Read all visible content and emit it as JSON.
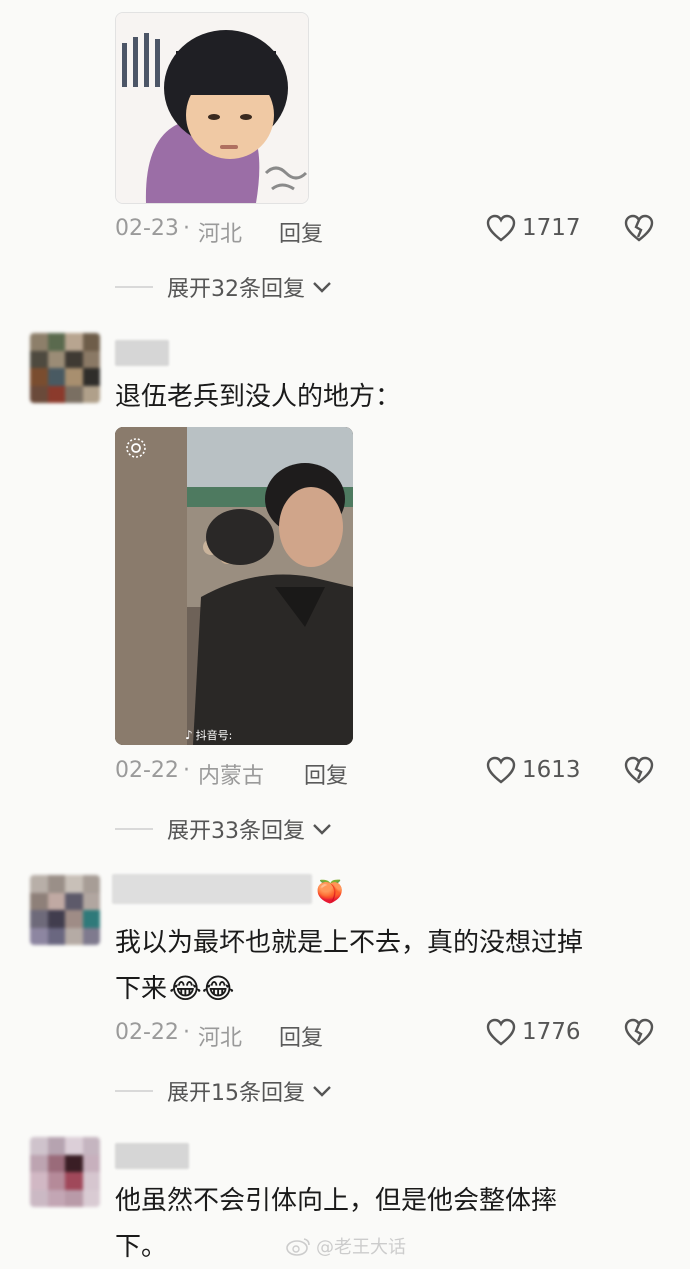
{
  "comments": [
    {
      "date": "02-23",
      "sep": "·",
      "region": "河北",
      "reply_label": "回复",
      "likes": "1717",
      "expand_label": "展开32条回复"
    },
    {
      "text": "退伍老兵到没人的地方：",
      "video_source": "抖音号:",
      "date": "02-22",
      "sep": "·",
      "region": "内蒙古",
      "reply_label": "回复",
      "likes": "1613",
      "expand_label": "展开33条回复"
    },
    {
      "text_line1": "我以为最坏也就是上不去，真的没想过掉",
      "text_line2": "下来",
      "emoji": [
        "😂",
        "😂"
      ],
      "date": "02-22",
      "sep": "·",
      "region": "河北",
      "reply_label": "回复",
      "likes": "1776",
      "expand_label": "展开15条回复"
    },
    {
      "text_line1": "他虽然不会引体向上，但是他会整体摔",
      "text_line2": "下。"
    }
  ],
  "watermark": "@老王大话",
  "colors": {
    "background": "#fafaf8",
    "meta": "#9a9a9a",
    "text": "#1a1a1a"
  },
  "icons": [
    "heart-outline-icon",
    "broken-heart-icon",
    "chevron-down-icon",
    "weibo-logo-icon"
  ]
}
